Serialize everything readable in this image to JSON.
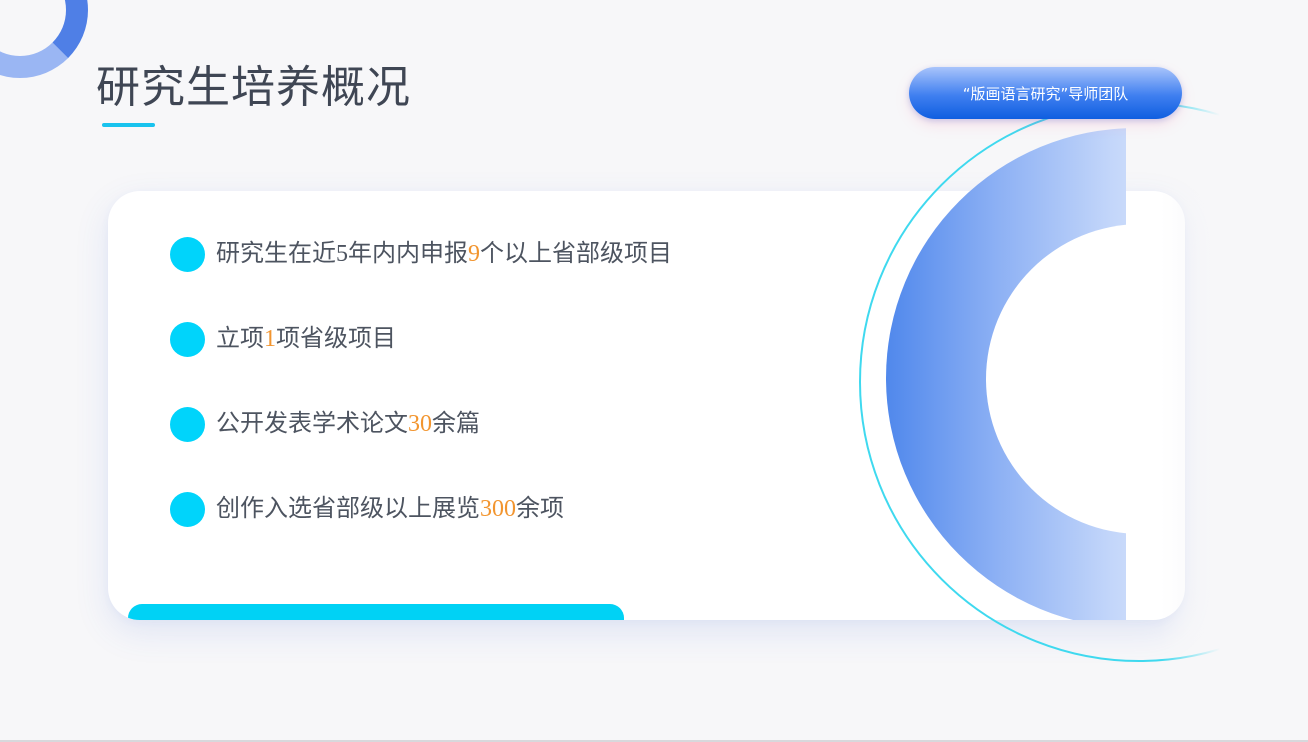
{
  "header": {
    "title": "研究生培养概况",
    "team_badge": "“版画语言研究”导师团队"
  },
  "bullets": [
    {
      "before": "研究生在近5年内内申报",
      "highlight": "9",
      "after": "个以上省部级项目"
    },
    {
      "before": "立项",
      "highlight": "1",
      "after": "项省级项目"
    },
    {
      "before": "公开发表学术论文",
      "highlight": "30",
      "after": "余篇"
    },
    {
      "before": "创作入选省部级以上展览",
      "highlight": "300",
      "after": "余项"
    }
  ],
  "colors": {
    "highlight": "#f2952f",
    "accent_cyan": "#00d4fb",
    "badge_blue": "#0f5ee0",
    "title_text": "#3f4654",
    "body_text": "#4d5460"
  },
  "icons": {
    "bullet_marker": "filled-circle",
    "decoration_top_left": "ring-arc",
    "decoration_right": "crescent-ring"
  }
}
